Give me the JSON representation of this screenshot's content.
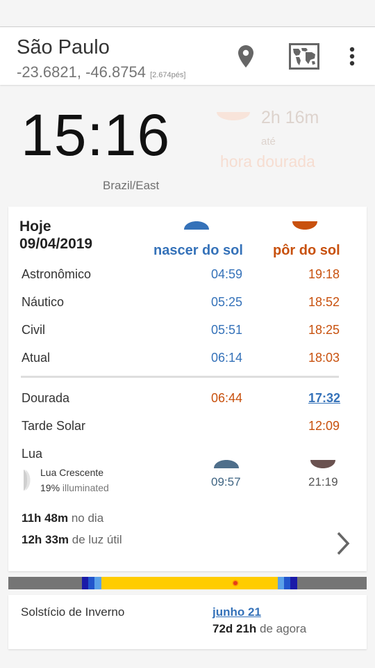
{
  "location": {
    "name": "São Paulo",
    "coordinates": "-23.6821, -46.8754",
    "elevation": "[2.674pés]"
  },
  "icons": {
    "pin": "location-pin-icon",
    "map": "world-map-icon",
    "more": "more-vert-icon"
  },
  "clock": {
    "time": "15:16",
    "timezone": "Brazil/East"
  },
  "golden_hour_countdown": {
    "time_left": "2h 16m",
    "until": "até",
    "event": "hora dourada"
  },
  "today": {
    "label": "Hoje",
    "date": "09/04/2019"
  },
  "columns": {
    "sunrise": "nascer do sol",
    "sunset": "pôr do sol"
  },
  "twilight_rows": [
    {
      "label": "Astronômico",
      "rise": "04:59",
      "set": "19:18"
    },
    {
      "label": "Náutico",
      "rise": "05:25",
      "set": "18:52"
    },
    {
      "label": "Civil",
      "rise": "05:51",
      "set": "18:25"
    },
    {
      "label": "Atual",
      "rise": "06:14",
      "set": "18:03"
    }
  ],
  "golden": {
    "label": "Dourada",
    "rise": "06:44",
    "set": "17:32"
  },
  "noon": {
    "label": "Tarde Solar",
    "time": "12:09"
  },
  "moon": {
    "label": "Lua",
    "phase": "Lua Crescente",
    "illum_pct": "19%",
    "illum_text": "illuminated",
    "rise": "09:57",
    "set": "21:19"
  },
  "day_length": {
    "value": "11h 48m",
    "text": "no dia"
  },
  "daylight_useful": {
    "value": "12h 33m",
    "text": "de luz útil"
  },
  "solstice": {
    "label": "Solstício de Inverno",
    "date": "junho 21",
    "countdown": "72d 21h",
    "countdown_text": "de agora"
  },
  "colors": {
    "sunrise": "#3572b9",
    "sunset": "#c8510e",
    "night": "#757575",
    "day": "#ffcc00"
  }
}
